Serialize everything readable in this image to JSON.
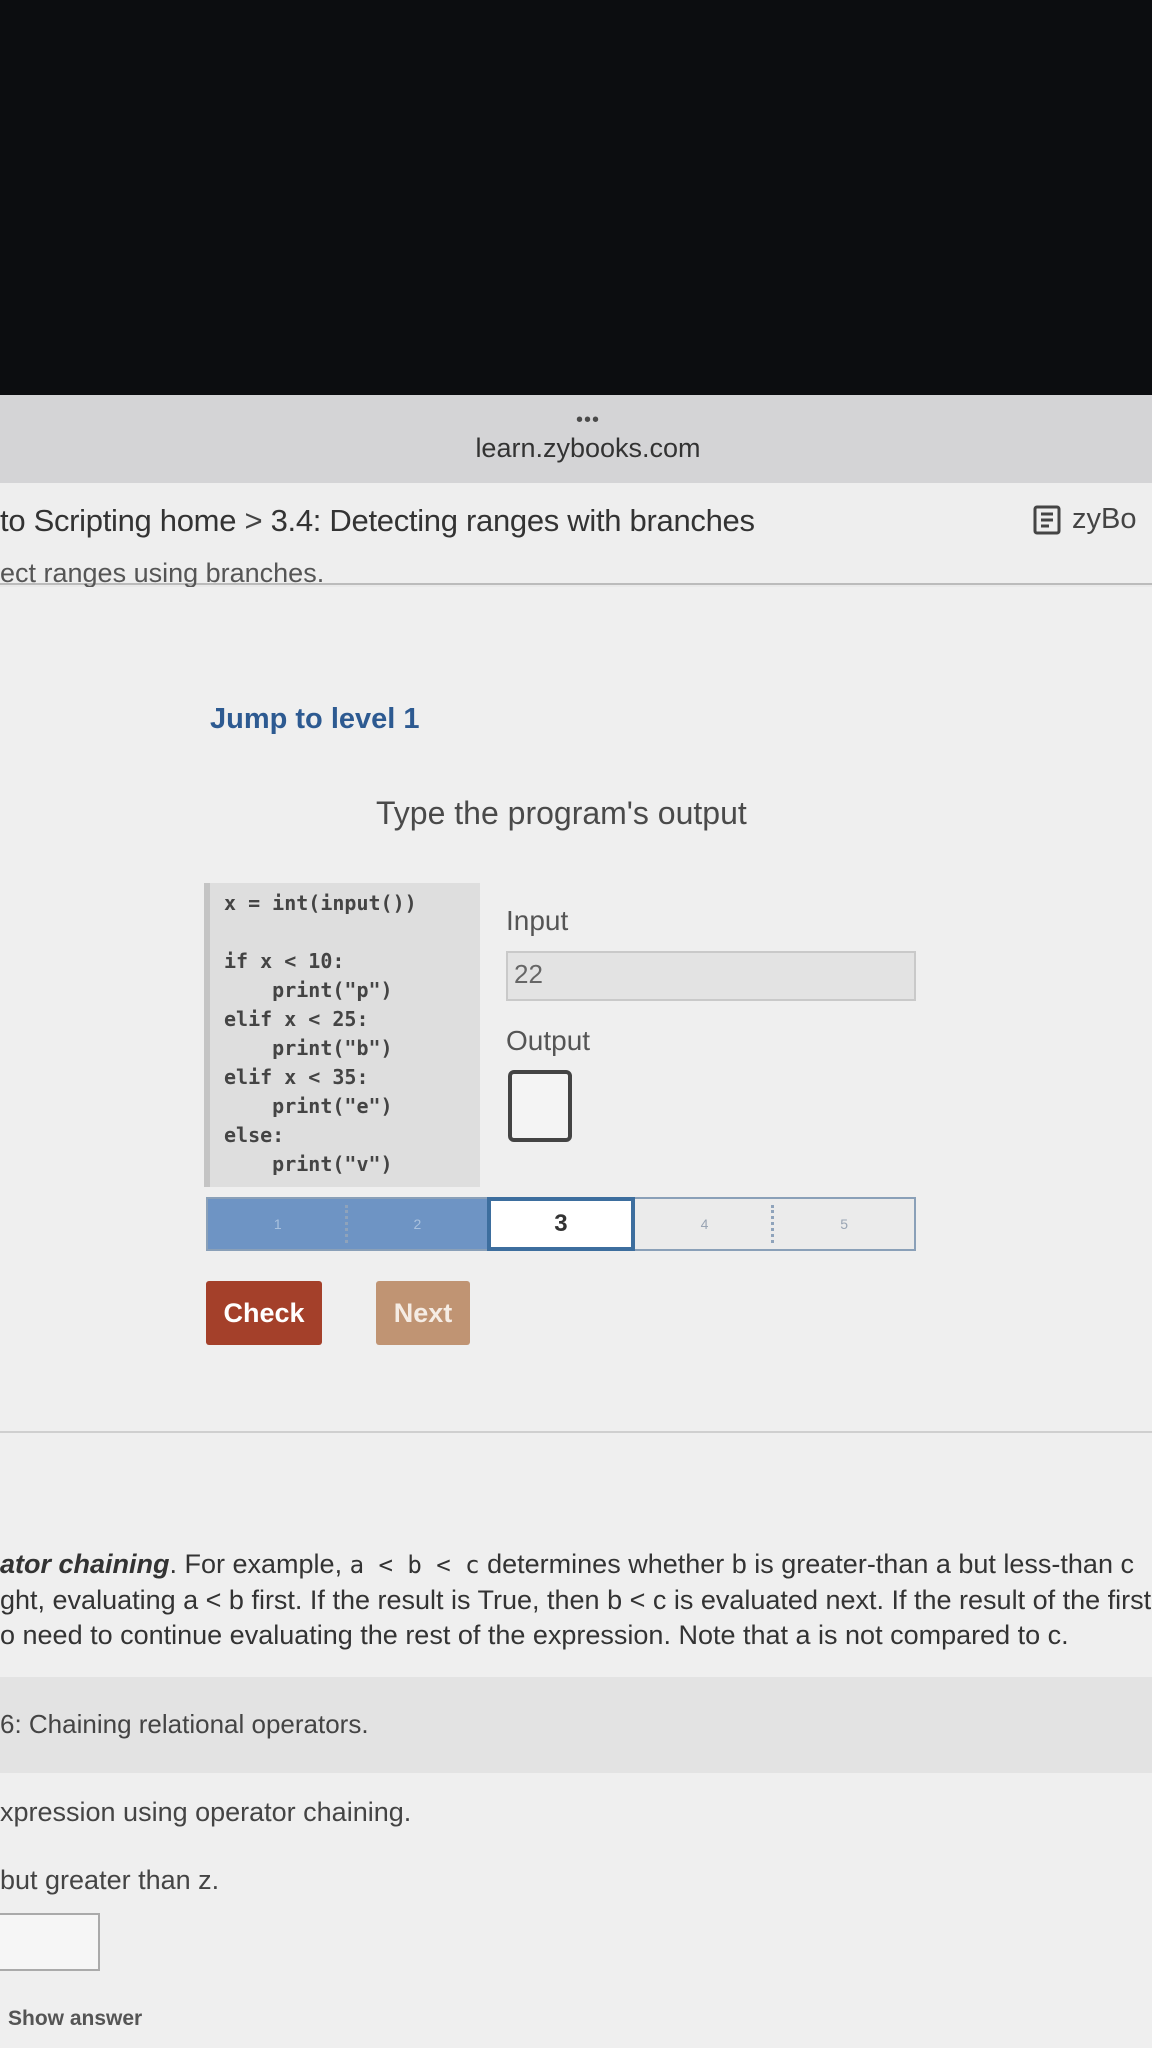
{
  "browser": {
    "dots": "•••",
    "url": "learn.zybooks.com"
  },
  "breadcrumb": {
    "part1": "to Scripting home",
    "separator": ">",
    "part2": "3.4: Detecting ranges with branches",
    "zybooks_label": "zyBo"
  },
  "section": {
    "cut_title": "ect ranges using branches."
  },
  "activity": {
    "jump_label": "Jump to level 1",
    "instruction": "Type the program's output",
    "code": [
      "x = int(input())",
      "",
      "if x < 10:",
      "    print(\"p\")",
      "elif x < 25:",
      "    print(\"b\")",
      "elif x < 35:",
      "    print(\"e\")",
      "else:",
      "    print(\"v\")"
    ],
    "input_label": "Input",
    "input_value": "22",
    "output_label": "Output",
    "output_value": "",
    "levels": [
      "1",
      "2",
      "3",
      "4",
      "5"
    ],
    "current_level": "3",
    "check_label": "Check",
    "next_label": "Next"
  },
  "paragraph": {
    "line1_bold": "ator chaining",
    "line1_a": ". For example, ",
    "line1_code": "a < b < c",
    "line1_b": " determines whether b is greater-than a but less-than c",
    "line2": "ght, evaluating a < b first. If the result is True, then b < c is evaluated next. If the result of the first",
    "line3": "o need to continue evaluating the rest of the expression. Note that a is not compared to c."
  },
  "participation": {
    "title": "6: Chaining relational operators.",
    "task": "xpression using operator chaining.",
    "subtask": "but greater than z.",
    "answer_value": "",
    "show_answer_label": "Show answer"
  },
  "colors": {
    "accent_blue": "#2d5a91",
    "check_button": "#a4402a",
    "next_button": "#c09473",
    "level_done": "#6e94c4"
  }
}
